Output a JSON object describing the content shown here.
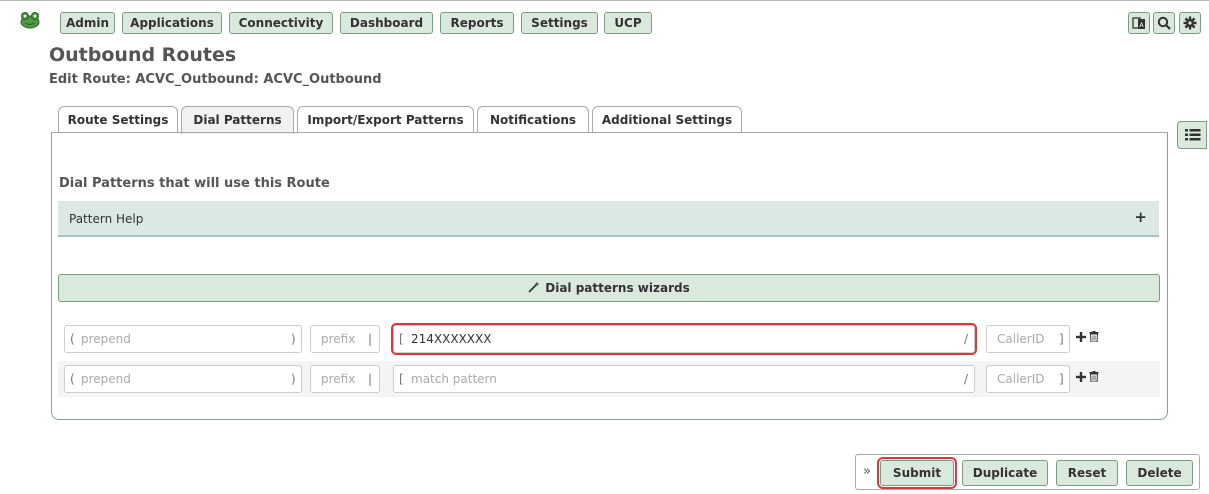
{
  "nav": {
    "items": [
      {
        "label": "Admin"
      },
      {
        "label": "Applications"
      },
      {
        "label": "Connectivity"
      },
      {
        "label": "Dashboard"
      },
      {
        "label": "Reports"
      },
      {
        "label": "Settings"
      },
      {
        "label": "UCP"
      }
    ],
    "icons": [
      "language-icon",
      "search-icon",
      "gear-icon"
    ]
  },
  "page": {
    "title": "Outbound Routes",
    "subtitle": "Edit Route: ACVC_Outbound: ACVC_Outbound"
  },
  "tabs": [
    {
      "label": "Route Settings",
      "active": false
    },
    {
      "label": "Dial Patterns",
      "active": true
    },
    {
      "label": "Import/Export Patterns",
      "active": false
    },
    {
      "label": "Notifications",
      "active": false
    },
    {
      "label": "Additional Settings",
      "active": false
    }
  ],
  "dial_patterns": {
    "heading": "Dial Patterns that will use this Route",
    "help_label": "Pattern Help",
    "help_toggle": "+",
    "wizard_label": "Dial patterns wizards",
    "rows": [
      {
        "prepend_placeholder": "prepend",
        "prefix_placeholder": "prefix",
        "match_value": "214XXXXXXX",
        "match_placeholder": "match pattern",
        "callerid_placeholder": "CallerID"
      },
      {
        "prepend_placeholder": "prepend",
        "prefix_placeholder": "prefix",
        "match_value": "",
        "match_placeholder": "match pattern",
        "callerid_placeholder": "CallerID"
      }
    ],
    "brackets": {
      "open_paren": "(",
      "close_paren": ")",
      "pipe": "|",
      "open_bracket": "[",
      "slash": "/",
      "close_bracket": "]"
    }
  },
  "actions": {
    "expand": "»",
    "submit": "Submit",
    "duplicate": "Duplicate",
    "reset": "Reset",
    "delete": "Delete"
  },
  "colors": {
    "button_bg": "#d9eadc",
    "button_border": "#7c9b82",
    "highlight": "#d9393e",
    "help_bg": "#dbe8e6"
  }
}
